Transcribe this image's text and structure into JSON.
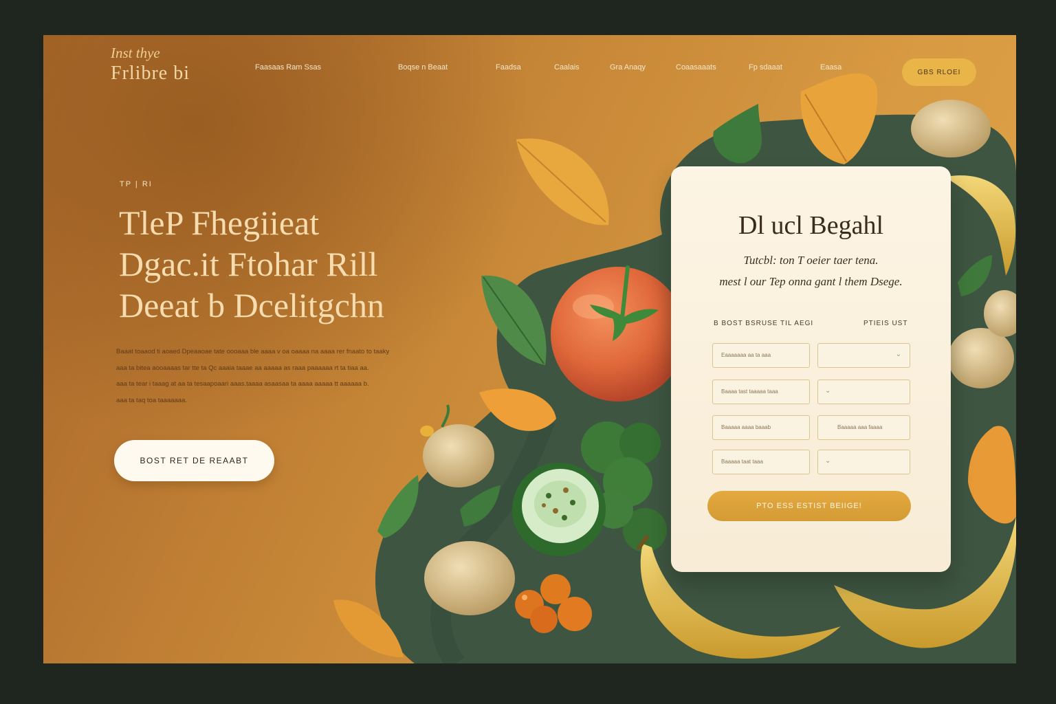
{
  "logo": {
    "script": "Inst thye",
    "main": "Frlibre bi"
  },
  "nav": {
    "items": [
      "Faasaas Ram Ssas",
      "Boqse n Beaat",
      "Faadsa",
      "Caalais",
      "Gra Anaqy",
      "Coaasaaats",
      "Fp sdaaat",
      "Eaasa"
    ],
    "cta": "GBS RLOEI"
  },
  "hero": {
    "eyebrow": "TP | RI",
    "headline": [
      "TleP Fhegiieat",
      "Dgac.it Ftohar Rill",
      "Deeat b Dcelitgchn"
    ],
    "body": [
      "Baaat toaaod ti aoaed Dpeaaoae tate oooaaa ble aaaa v oa oaaaa na aaaa rer fnaato to taaky",
      "aaa ta bitea aooaaaas tar tte ta Qc aaaia taaae aa aaaaa as raaa paaaaaa rt ta tiaa aa.",
      "aaa ta tear i taaag at aa ta tesaapoaari aaas.taaaa asaasaa ta aaaa aaaaa tt aaaaaa b.",
      "aaa ta taq toa taaaaaaa."
    ],
    "button": "BOST RET DE REAABT"
  },
  "card": {
    "title": "Dl ucl Begahl",
    "subtitle": [
      "Tutcbl: ton T oeier taer tena.",
      "mest l our Tep onna gant l them Dsege."
    ],
    "label_left": "B BOST BSRUSE TIL AEGI",
    "label_right": "PTIEIS UST",
    "fields": [
      {
        "left": "Eaaaaaaa aa ta aaa",
        "right": ""
      },
      {
        "left": "Baaaa tast taaaaa taaa",
        "right": ""
      },
      {
        "left": "Baaaaa aaaa baaab",
        "right": "Baaaaa aaa faaaa"
      },
      {
        "left": "Baaaaa taat taaa",
        "right": ""
      }
    ],
    "button": "PTO ESS ESTIST BEIIGE!"
  },
  "colors": {
    "background": "#1f2620",
    "accent": "#e4aa40",
    "green": "#3e5542",
    "card": "#fcf4e4"
  }
}
